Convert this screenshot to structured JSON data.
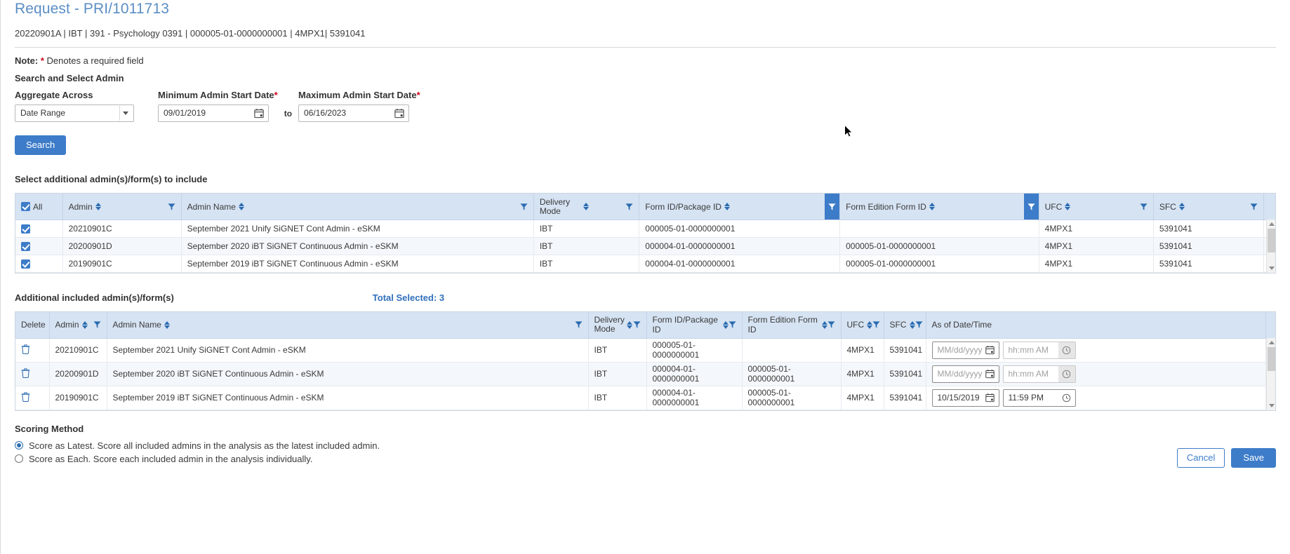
{
  "header": {
    "title": "Request - PRI/1011713",
    "breadcrumb": "20220901A | IBT | 391 - Psychology 0391 | 000005-01-0000000001 | 4MPX1| 5391041",
    "note_prefix": "Note:",
    "note_star": "*",
    "note_text": "Denotes a required field",
    "section_title": "Search and Select Admin"
  },
  "search_form": {
    "aggregate_label": "Aggregate Across",
    "aggregate_value": "Date Range",
    "min_date_label": "Minimum Admin Start Date",
    "min_date_required": "*",
    "min_date_value": "09/01/2019",
    "to_label": "to",
    "max_date_label": "Maximum Admin Start Date",
    "max_date_required": "*",
    "max_date_value": "06/16/2023",
    "search_button": "Search"
  },
  "select_table": {
    "caption": "Select additional admin(s)/form(s) to include",
    "headers": {
      "all": "All",
      "admin": "Admin",
      "admin_name": "Admin Name",
      "delivery_mode": "Delivery Mode",
      "form_id": "Form ID/Package ID",
      "form_edition": "Form Edition Form ID",
      "ufc": "UFC",
      "sfc": "SFC"
    },
    "rows": [
      {
        "checked": true,
        "admin": "20210901C",
        "admin_name": "September 2021 Unify SiGNET Cont Admin - eSKM",
        "delivery_mode": "IBT",
        "form_id": "000005-01-0000000001",
        "form_edition": "",
        "ufc": "4MPX1",
        "sfc": "5391041"
      },
      {
        "checked": true,
        "admin": "20200901D",
        "admin_name": "September 2020 iBT SiGNET Continuous Admin - eSKM",
        "delivery_mode": "IBT",
        "form_id": "000004-01-0000000001",
        "form_edition": "000005-01-0000000001",
        "ufc": "4MPX1",
        "sfc": "5391041"
      },
      {
        "checked": true,
        "admin": "20190901C",
        "admin_name": "September 2019 iBT SiGNET Continuous Admin - eSKM",
        "delivery_mode": "IBT",
        "form_id": "000004-01-0000000001",
        "form_edition": "000005-01-0000000001",
        "ufc": "4MPX1",
        "sfc": "5391041"
      }
    ]
  },
  "included_table": {
    "caption": "Additional included admin(s)/form(s)",
    "total_selected": "Total Selected: 3",
    "headers": {
      "delete": "Delete",
      "admin": "Admin",
      "admin_name": "Admin Name",
      "delivery_mode": "Delivery Mode",
      "form_id": "Form ID/Package ID",
      "form_edition": "Form Edition Form ID",
      "ufc": "UFC",
      "sfc": "SFC",
      "as_of": "As of Date/Time"
    },
    "date_placeholder": "MM/dd/yyyy",
    "time_placeholder": "hh:mm AM",
    "rows": [
      {
        "admin": "20210901C",
        "admin_name": "September 2021 Unify SiGNET Cont Admin - eSKM",
        "delivery_mode": "IBT",
        "form_id": "000005-01-0000000001",
        "form_edition": "",
        "ufc": "4MPX1",
        "sfc": "5391041",
        "as_of_date": "",
        "as_of_time": "",
        "time_enabled": false
      },
      {
        "admin": "20200901D",
        "admin_name": "September 2020 iBT SiGNET Continuous Admin - eSKM",
        "delivery_mode": "IBT",
        "form_id": "000004-01-0000000001",
        "form_edition": "000005-01-0000000001",
        "ufc": "4MPX1",
        "sfc": "5391041",
        "as_of_date": "",
        "as_of_time": "",
        "time_enabled": false
      },
      {
        "admin": "20190901C",
        "admin_name": "September 2019 iBT SiGNET Continuous Admin - eSKM",
        "delivery_mode": "IBT",
        "form_id": "000004-01-0000000001",
        "form_edition": "000005-01-0000000001",
        "ufc": "4MPX1",
        "sfc": "5391041",
        "as_of_date": "10/15/2019",
        "as_of_time": "11:59 PM",
        "time_enabled": true
      }
    ]
  },
  "scoring": {
    "title": "Scoring Method",
    "option_latest": "Score as Latest. Score all included admins in the analysis as the latest included admin.",
    "option_each": "Score as Each. Score each included admin in the analysis individually.",
    "selected": "latest"
  },
  "footer": {
    "cancel": "Cancel",
    "save": "Save"
  },
  "colors": {
    "accent": "#3d7cc9",
    "title": "#5b8ec4",
    "header_bg": "#d6e3f3",
    "required": "#d0021b",
    "link": "#2f6fba"
  }
}
